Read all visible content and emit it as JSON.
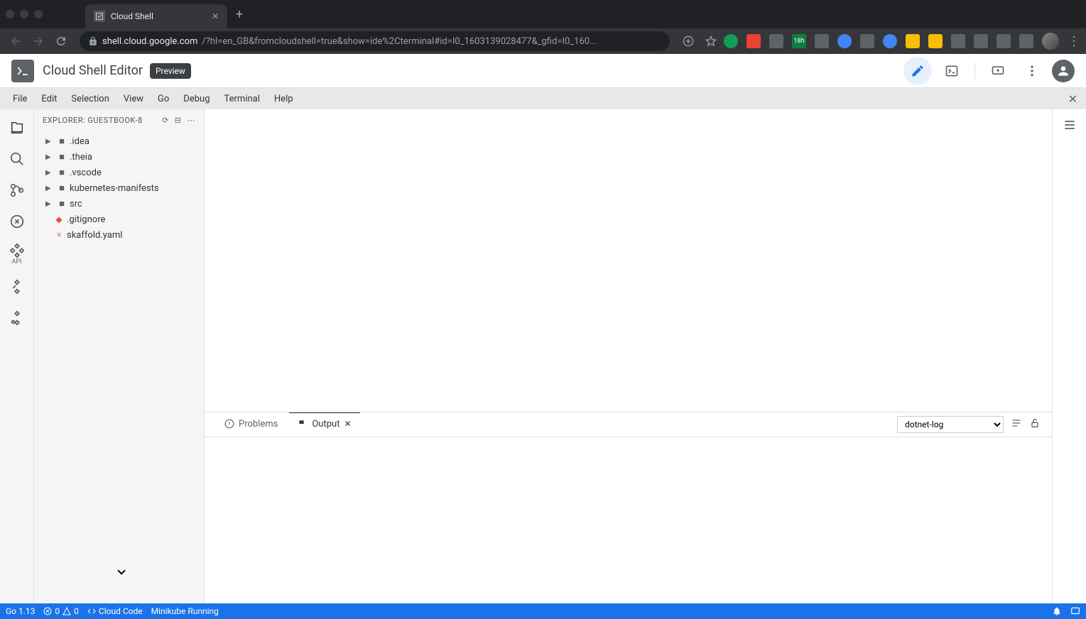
{
  "browser": {
    "tab_title": "Cloud Shell",
    "url_domain": "shell.cloud.google.com",
    "url_path": "/?hl=en_GB&fromcloudshell=true&show=ide%2Cterminal#id=I0_1603139028477&_gfid=I0_160...",
    "badge_text": "18h"
  },
  "header": {
    "title": "Cloud Shell Editor",
    "badge": "Preview"
  },
  "menu": {
    "items": [
      "File",
      "Edit",
      "Selection",
      "View",
      "Go",
      "Debug",
      "Terminal",
      "Help"
    ]
  },
  "explorer": {
    "title": "EXPLORER: GUESTBOOK-8",
    "tree": [
      {
        "name": ".idea",
        "type": "folder"
      },
      {
        "name": ".theia",
        "type": "folder"
      },
      {
        "name": ".vscode",
        "type": "folder"
      },
      {
        "name": "kubernetes-manifests",
        "type": "folder"
      },
      {
        "name": "src",
        "type": "folder"
      },
      {
        "name": ".gitignore",
        "type": "file",
        "icon": "git"
      },
      {
        "name": "skaffold.yaml",
        "type": "file",
        "icon": "yaml"
      }
    ]
  },
  "panel": {
    "tabs": {
      "problems": "Problems",
      "output": "Output"
    },
    "select_value": "dotnet-log"
  },
  "status": {
    "go": "Go 1.13",
    "errors": "0",
    "warnings": "0",
    "cloud_code": "Cloud Code",
    "minikube": "Minikube Running"
  },
  "activity": {
    "api_label": "API"
  }
}
